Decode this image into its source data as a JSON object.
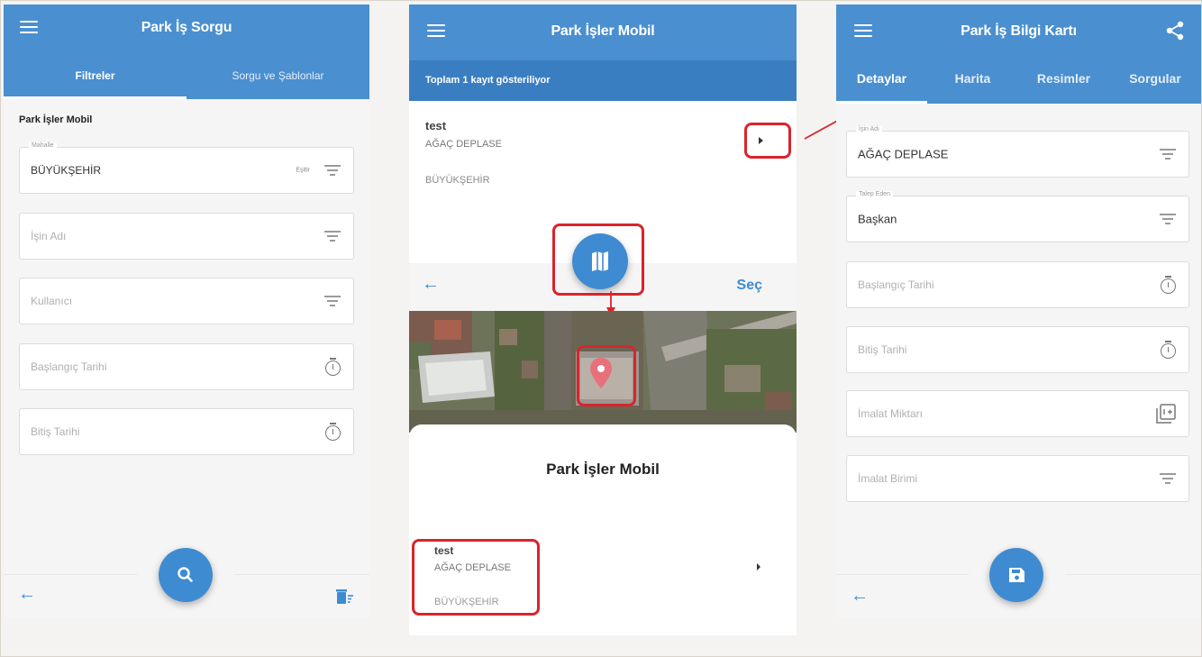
{
  "screen1": {
    "title": "Park İş Sorgu",
    "tabs": [
      "Filtreler",
      "Sorgu ve Şablonlar"
    ],
    "section_title": "Park İşler Mobil",
    "fields": [
      {
        "label": "Mahalle",
        "value": "BÜYÜKŞEHİR",
        "suffix": "Eşitir",
        "icon": "filter-icon"
      },
      {
        "label": "",
        "placeholder": "İşin Adı",
        "icon": "filter-icon"
      },
      {
        "label": "",
        "placeholder": "Kullanıcı",
        "icon": "filter-icon"
      },
      {
        "label": "",
        "placeholder": "Başlangıç Tarihi",
        "icon": "timer-icon"
      },
      {
        "label": "",
        "placeholder": "Bitiş Tarihi",
        "icon": "timer-icon"
      }
    ]
  },
  "screen2": {
    "title": "Park İşler Mobil",
    "record_count_text": "Toplam 1 kayıt gösteriliyor",
    "record": {
      "name": "test",
      "work": "AĞAÇ DEPLASE",
      "district": "BÜYÜKŞEHİR"
    },
    "select_label": "Seç",
    "sheet_title": "Park İşler Mobil",
    "sheet_record": {
      "name": "test",
      "work": "AĞAÇ DEPLASE",
      "district": "BÜYÜKŞEHİR"
    }
  },
  "screen3": {
    "title": "Park İş Bilgi Kartı",
    "tabs": [
      "Detaylar",
      "Harita",
      "Resimler",
      "Sorgular"
    ],
    "fields": [
      {
        "label": "İşin Adı",
        "value": "AĞAÇ DEPLASE",
        "icon": "filter-icon"
      },
      {
        "label": "Talep Eden",
        "value": "Başkan",
        "icon": "filter-icon"
      },
      {
        "label": "",
        "placeholder": "Başlangıç Tarihi",
        "icon": "timer-icon"
      },
      {
        "label": "",
        "placeholder": "Bitiş Tarihi",
        "icon": "timer-icon"
      },
      {
        "label": "",
        "placeholder": "İmalat Miktarı",
        "icon": "number-box-icon"
      },
      {
        "label": "",
        "placeholder": "İmalat Birimi",
        "icon": "filter-icon"
      }
    ]
  },
  "colors": {
    "primary": "#4a8fd0",
    "dark_primary": "#3a7ec2",
    "highlight": "#d9242b",
    "marker": "#e8707a"
  }
}
